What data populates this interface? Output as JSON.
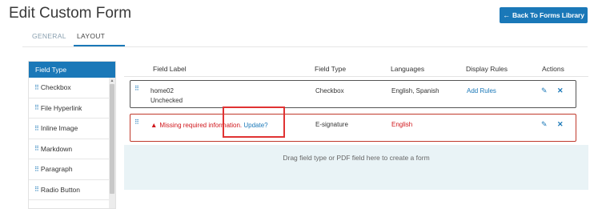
{
  "header": {
    "title": "Edit Custom Form",
    "back_button": "Back To Forms Library",
    "back_arrow": "←"
  },
  "tabs": [
    {
      "label": "GENERAL",
      "active": false
    },
    {
      "label": "LAYOUT",
      "active": true
    }
  ],
  "field_type_panel": {
    "title": "Field Type",
    "drag_glyph": "⠿",
    "items": [
      "Checkbox",
      "File Hyperlink",
      "Inline Image",
      "Markdown",
      "Paragraph",
      "Radio Button"
    ]
  },
  "grid": {
    "columns": [
      "Field Label",
      "Field Type",
      "Languages",
      "Display Rules",
      "Actions"
    ],
    "rows": [
      {
        "label": "home02",
        "sublabel": "Unchecked",
        "type": "Checkbox",
        "languages": "English, Spanish",
        "display_rules": "Add Rules",
        "error": false
      },
      {
        "label": "Missing required information.",
        "label_link": "Update?",
        "type": "E-signature",
        "languages": "English",
        "display_rules": "",
        "error": true
      }
    ]
  },
  "dropzone": {
    "text": "Drag field type or PDF field here to create a form"
  },
  "colors": {
    "accent": "#1a78b8",
    "error": "#d0161b",
    "highlight": "#e03333",
    "dropzone_bg": "#e9f3f6"
  },
  "icons": {
    "edit": "pencil-icon",
    "delete": "close-icon",
    "warning": "warning-icon",
    "drag": "drag-handle-icon"
  }
}
